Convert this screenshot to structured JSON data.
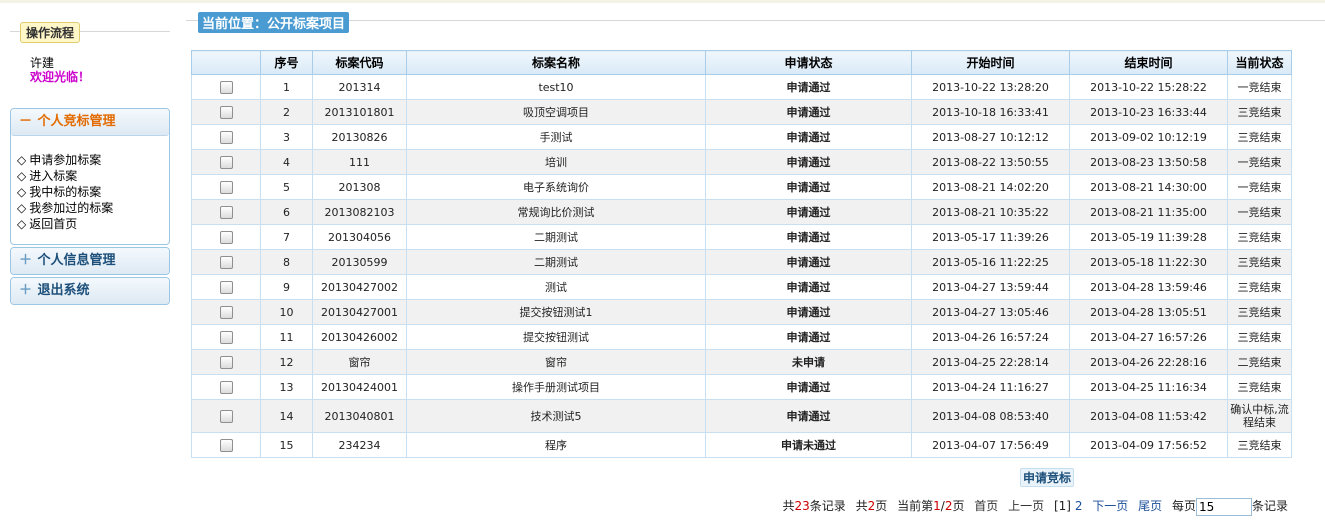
{
  "sidebar": {
    "flow_title": "操作流程",
    "user_name": "许建",
    "welcome": "欢迎光临！",
    "panels": [
      {
        "title": "个人竞标管理",
        "sign": "－",
        "items": [
          "申请参加标案",
          "进入标案",
          "我中标的标案",
          "我参加过的标案",
          "返回首页"
        ]
      },
      {
        "title": "个人信息管理",
        "sign": "＋"
      },
      {
        "title": "退出系统",
        "sign": "＋"
      }
    ],
    "item_bullet": "◇"
  },
  "location": {
    "title": "当前位置：公开标案项目"
  },
  "table": {
    "headers": [
      "",
      "序号",
      "标案代码",
      "标案名称",
      "申请状态",
      "开始时间",
      "结束时间",
      "当前状态"
    ],
    "rows": [
      [
        "1",
        "201314",
        "test10",
        "申请通过",
        "2013-10-22 13:28:20",
        "2013-10-22 15:28:22",
        "一竞结束"
      ],
      [
        "2",
        "2013101801",
        "吸顶空调项目",
        "申请通过",
        "2013-10-18 16:33:41",
        "2013-10-23 16:33:44",
        "三竞结束"
      ],
      [
        "3",
        "20130826",
        "手测试",
        "申请通过",
        "2013-08-27 10:12:12",
        "2013-09-02 10:12:19",
        "三竞结束"
      ],
      [
        "4",
        "111",
        "培训",
        "申请通过",
        "2013-08-22 13:50:55",
        "2013-08-23 13:50:58",
        "一竞结束"
      ],
      [
        "5",
        "201308",
        "电子系统询价",
        "申请通过",
        "2013-08-21 14:02:20",
        "2013-08-21 14:30:00",
        "一竞结束"
      ],
      [
        "6",
        "2013082103",
        "常规询比价测试",
        "申请通过",
        "2013-08-21 10:35:22",
        "2013-08-21 11:35:00",
        "一竞结束"
      ],
      [
        "7",
        "201304056",
        "二期测试",
        "申请通过",
        "2013-05-17 11:39:26",
        "2013-05-19 11:39:28",
        "三竞结束"
      ],
      [
        "8",
        "20130599",
        "二期测试",
        "申请通过",
        "2013-05-16 11:22:25",
        "2013-05-18 11:22:30",
        "三竞结束"
      ],
      [
        "9",
        "20130427002",
        "测试",
        "申请通过",
        "2013-04-27 13:59:44",
        "2013-04-28 13:59:46",
        "三竞结束"
      ],
      [
        "10",
        "20130427001",
        "提交按钮测试1",
        "申请通过",
        "2013-04-27 13:05:46",
        "2013-04-28 13:05:51",
        "三竞结束"
      ],
      [
        "11",
        "20130426002",
        "提交按钮测试",
        "申请通过",
        "2013-04-26 16:57:24",
        "2013-04-27 16:57:26",
        "三竞结束"
      ],
      [
        "12",
        "窗帘",
        "窗帘",
        "未申请",
        "2013-04-25 22:28:14",
        "2013-04-26 22:28:16",
        "二竞结束"
      ],
      [
        "13",
        "20130424001",
        "操作手册测试项目",
        "申请通过",
        "2013-04-24 11:16:27",
        "2013-04-25 11:16:34",
        "三竞结束"
      ],
      [
        "14",
        "2013040801",
        "技术测试5",
        "申请通过",
        "2013-04-08 08:53:40",
        "2013-04-08 11:53:42",
        "确认中标,流程结束"
      ],
      [
        "15",
        "234234",
        "程序",
        "申请未通过",
        "2013-04-07 17:56:49",
        "2013-04-09 17:56:52",
        "三竞结束"
      ]
    ]
  },
  "apply_button": "申请竞标",
  "pager": {
    "total_prefix": "共",
    "total_records": "23",
    "total_suffix": "条记录",
    "pages_prefix": "共",
    "total_pages": "2",
    "pages_suffix": "页",
    "current_prefix": "当前第",
    "current_page": "1",
    "current_sep": "/",
    "current_total": "2",
    "current_suffix": "页",
    "first": "首页",
    "prev": "上一页",
    "page_current": "[1]",
    "page_2": "2",
    "next": "下一页",
    "last": "尾页",
    "per_page_prefix": "每页",
    "per_page_value": "15",
    "per_page_suffix": "条记录"
  },
  "colors": {
    "status_pass": "#117a11",
    "status_fail": "#d40000",
    "accent": "#4a9bd2"
  }
}
